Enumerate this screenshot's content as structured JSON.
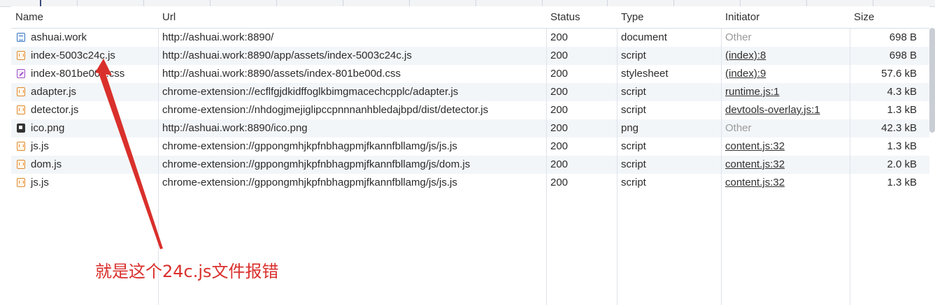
{
  "columns": {
    "name": "Name",
    "url": "Url",
    "status": "Status",
    "type": "Type",
    "initiator": "Initiator",
    "size": "Size"
  },
  "rows": [
    {
      "name": "ashuai.work",
      "icon": "document-icon",
      "url": "http://ashuai.work:8890/",
      "status": "200",
      "type": "document",
      "initiator": "Other",
      "initiator_link": false,
      "size": "698 B"
    },
    {
      "name": "index-5003c24c.js",
      "icon": "script-icon",
      "url": "http://ashuai.work:8890/app/assets/index-5003c24c.js",
      "status": "200",
      "type": "script",
      "initiator": "(index):8",
      "initiator_link": true,
      "size": "698 B"
    },
    {
      "name": "index-801be00d.css",
      "icon": "stylesheet-icon",
      "url": "http://ashuai.work:8890/assets/index-801be00d.css",
      "status": "200",
      "type": "stylesheet",
      "initiator": "(index):9",
      "initiator_link": true,
      "size": "57.6 kB"
    },
    {
      "name": "adapter.js",
      "icon": "script-icon",
      "url": "chrome-extension://ecflfgjdkidffoglkbimgmacechcpplc/adapter.js",
      "status": "200",
      "type": "script",
      "initiator": "runtime.js:1",
      "initiator_link": true,
      "size": "4.3 kB"
    },
    {
      "name": "detector.js",
      "icon": "script-icon",
      "url": "chrome-extension://nhdogjmejiglipccpnnnanhbledajbpd/dist/detector.js",
      "status": "200",
      "type": "script",
      "initiator": "devtools-overlay.js:1",
      "initiator_link": true,
      "size": "1.3 kB"
    },
    {
      "name": "ico.png",
      "icon": "image-icon",
      "url": "http://ashuai.work:8890/ico.png",
      "status": "200",
      "type": "png",
      "initiator": "Other",
      "initiator_link": false,
      "size": "42.3 kB"
    },
    {
      "name": "js.js",
      "icon": "script-icon",
      "url": "chrome-extension://gppongmhjkpfnbhagpmjfkannfbllamg/js/js.js",
      "status": "200",
      "type": "script",
      "initiator": "content.js:32",
      "initiator_link": true,
      "size": "1.3 kB"
    },
    {
      "name": "dom.js",
      "icon": "script-icon",
      "url": "chrome-extension://gppongmhjkpfnbhagpmjfkannfbllamg/js/dom.js",
      "status": "200",
      "type": "script",
      "initiator": "content.js:32",
      "initiator_link": true,
      "size": "2.0 kB"
    },
    {
      "name": "js.js",
      "icon": "script-icon",
      "url": "chrome-extension://gppongmhjkpfnbhagpmjfkannfbllamg/js/js.js",
      "status": "200",
      "type": "script",
      "initiator": "content.js:32",
      "initiator_link": true,
      "size": "1.3 kB"
    }
  ],
  "annotation": {
    "text": "就是这个24c.js文件报错",
    "color": "#d9302c"
  },
  "colors": {
    "alt_row": "#f3f6f9",
    "grid_line": "#dde3ea",
    "script_icon": "#e08a2a",
    "doc_icon": "#3b78c4",
    "css_icon": "#a04fc8"
  }
}
